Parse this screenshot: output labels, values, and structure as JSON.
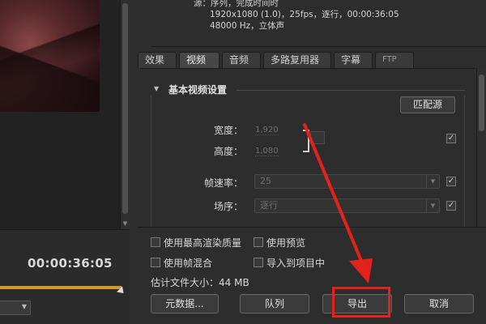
{
  "summary": {
    "line1": "源：序列，完成时间时",
    "line2": "1920x1080 (1.0)，25fps，逐行，00:00:36:05",
    "line3": "48000 Hz，立体声"
  },
  "tabs": [
    {
      "label": "效果"
    },
    {
      "label": "视频"
    },
    {
      "label": "音频"
    },
    {
      "label": "多路复用器"
    },
    {
      "label": "字幕"
    },
    {
      "label": "FTP"
    }
  ],
  "video_settings": {
    "section_title": "基本视频设置",
    "match_source_label": "匹配源",
    "width_label": "宽度：",
    "width_value": "1,920",
    "height_label": "高度：",
    "height_value": "1,080",
    "frame_rate_label": "帧速率：",
    "frame_rate_value": "25",
    "field_order_label": "场序：",
    "field_order_value": "逐行"
  },
  "options": {
    "max_render_quality": "使用最高渲染质量",
    "use_preview": "使用预览",
    "frame_blending": "使用帧混合",
    "import_into_project": "导入到项目中",
    "estimated_file_size": "估计文件大小：44 MB"
  },
  "buttons": {
    "metadata": "元数据...",
    "queue": "队列",
    "export": "导出",
    "cancel": "取消"
  },
  "preview": {
    "timecode": "00:00:36:05"
  },
  "colors": {
    "highlight": "#e3221c",
    "timeline": "#d59a1c"
  }
}
